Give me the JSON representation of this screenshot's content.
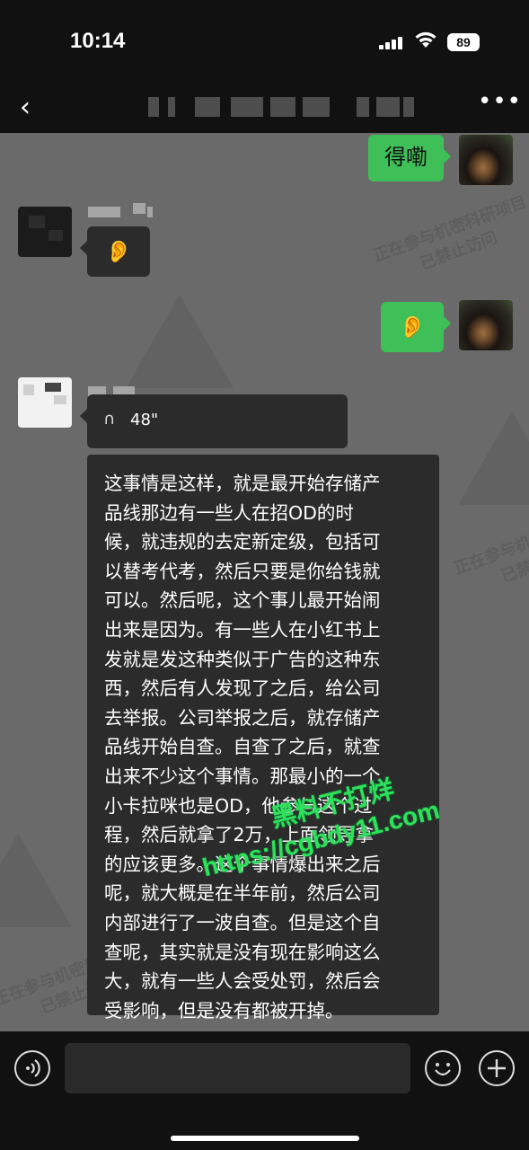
{
  "status_bar": {
    "time": "10:14",
    "battery": "89"
  },
  "nav": {
    "back_icon": "chevron-left-icon",
    "title": "",
    "more_icon": "more-icon"
  },
  "messages": [
    {
      "from": "me",
      "type": "text",
      "text": "得嘞"
    },
    {
      "from": "other",
      "type": "voice_icon",
      "icon": "ear-icon"
    },
    {
      "from": "me",
      "type": "voice_icon",
      "icon": "ear-icon"
    },
    {
      "from": "other",
      "type": "voice",
      "duration": "48\""
    },
    {
      "from": "other",
      "type": "transcript",
      "text": "这事情是这样，就是最开始存储产\n品线那边有一些人在招OD的时\n候，就违规的去定新定级，包括可\n以替考代考，然后只要是你给钱就\n可以。然后呢，这个事儿最开始闹\n出来是因为。有一些人在小红书上\n发就是发这种类似于广告的这种东\n西，然后有人发现了之后，给公司\n去举报。公司举报之后，就存储产\n品线开始自查。自查了之后，就查\n出来不少这个事情。那最小的一个\n小卡拉咪也是OD，他参与这个过\n程，然后就拿了2万，上面领导拿\n的应该更多。这个事情爆出来之后\n呢，就大概是在半年前，然后公司\n内部进行了一波自查。但是这个自\n查呢，其实就是没有现在影响这么\n大，就有一些人会受处罚，然后会\n受影响，但是没有都被开掉。"
    }
  ],
  "watermarks": {
    "notice_line1": "正在参与机密科研项目",
    "notice_line2": "已禁止访问",
    "site_line1": "黑料不打烊",
    "site_line2": "https://cgbdy11.com"
  },
  "input_bar": {
    "voice_icon": "voice-icon",
    "emoji_icon": "emoji-icon",
    "plus_icon": "plus-icon"
  },
  "colors": {
    "chat_bg": "#6a6a6a",
    "green_bubble": "#3fbf58",
    "dark_bubble": "#2b2b2b",
    "bars": "#111111"
  }
}
